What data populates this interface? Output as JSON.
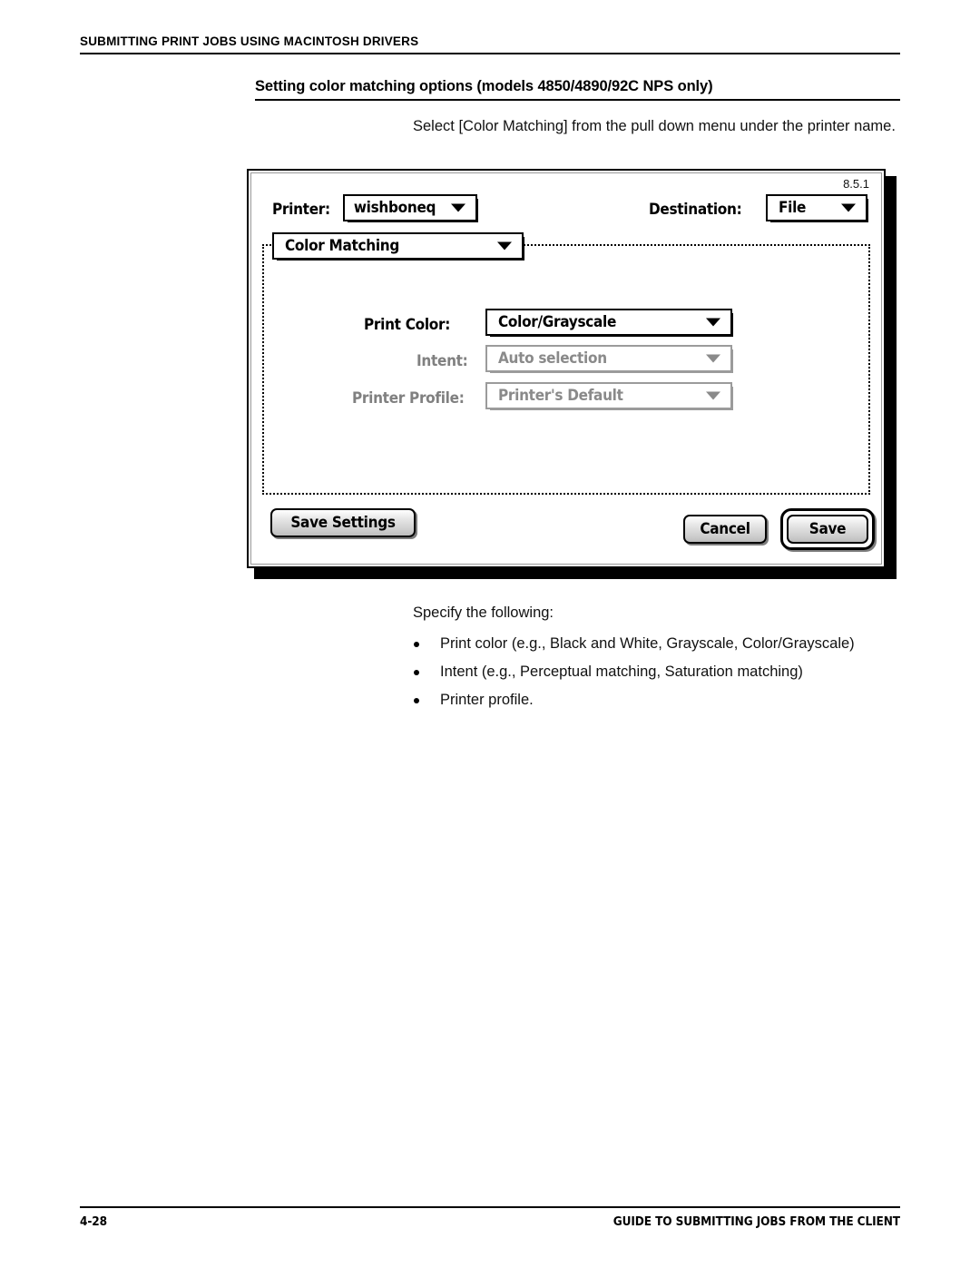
{
  "page": {
    "running_header": "SUBMITTING PRINT JOBS USING MACINTOSH DRIVERS",
    "section_heading": "Setting color matching options (models 4850/4890/92C NPS only)",
    "intro_paragraph": "Select [Color Matching] from the pull down menu under the printer name.",
    "specify_paragraph": "Specify the following:",
    "bullets": [
      "Print color (e.g., Black and White, Grayscale, Color/Grayscale)",
      "Intent (e.g., Perceptual matching, Saturation matching)",
      "Printer profile."
    ],
    "footer": {
      "page_number": "4-28",
      "guide_text": "GUIDE TO SUBMITTING JOBS FROM THE CLIENT"
    }
  },
  "dialog": {
    "version": "8.5.1",
    "printer": {
      "label": "Printer:",
      "value": "wishboneq"
    },
    "destination": {
      "label": "Destination:",
      "value": "File"
    },
    "pane_menu": {
      "value": "Color Matching"
    },
    "fields": [
      {
        "label": "Print Color:",
        "value": "Color/Grayscale",
        "enabled": true
      },
      {
        "label": "Intent:",
        "value": "Auto selection",
        "enabled": false
      },
      {
        "label": "Printer Profile:",
        "value": "Printer's Default",
        "enabled": false
      }
    ],
    "buttons": {
      "save_settings": "Save Settings",
      "cancel": "Cancel",
      "save": "Save"
    }
  },
  "colors": {
    "ink": "#000000",
    "disabled_gray": "#8a8a8a",
    "disabled_border": "#9b9b9b",
    "button_face": "#cfcfcf",
    "shadow": "#7d7d7d"
  }
}
